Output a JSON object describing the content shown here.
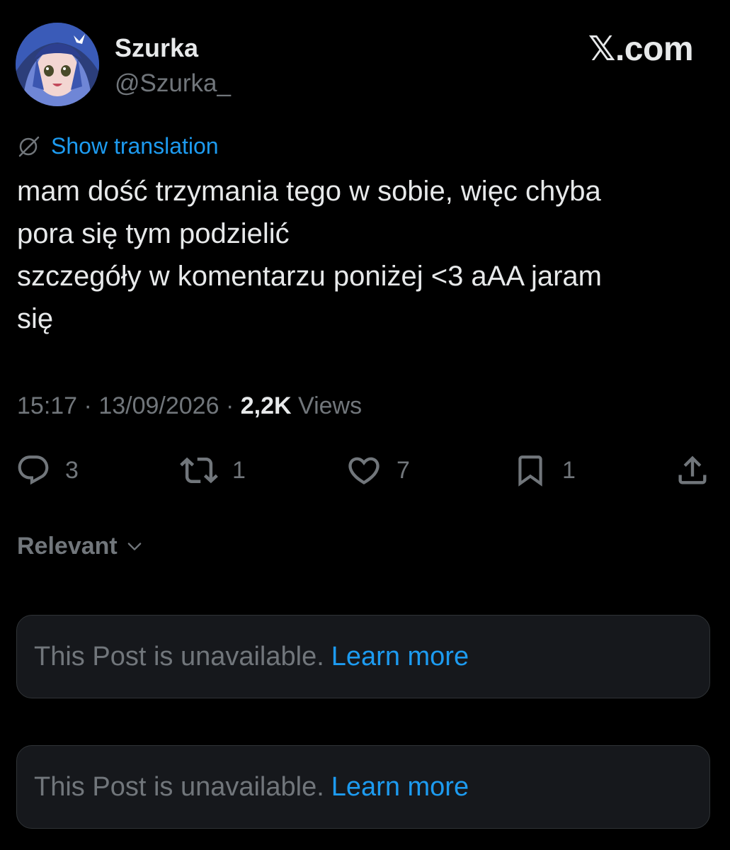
{
  "author": {
    "display_name": "Szurka",
    "handle": "@Szurka_"
  },
  "brand": "𝕏.com",
  "translation": {
    "label": "Show translation",
    "icon": "globe-slash-icon"
  },
  "post": {
    "lines": [
      "mam dość trzymania tego w sobie, więc chyba",
      "pora się tym podzielić",
      "szczegóły w komentarzu poniżej <3 aAA jaram",
      "się"
    ]
  },
  "meta": {
    "time": "15:17",
    "separator": "·",
    "date": "13/09/2026",
    "views_count": "2,2K",
    "views_label": "Views"
  },
  "actions": {
    "replies": "3",
    "reposts": "1",
    "likes": "7",
    "bookmarks": "1"
  },
  "sort": {
    "label": "Relevant"
  },
  "replies": [
    {
      "text": "This Post is unavailable.",
      "link": "Learn more"
    },
    {
      "text": "This Post is unavailable.",
      "link": "Learn more"
    }
  ],
  "colors": {
    "background": "#000000",
    "primary_text": "#e7e9ea",
    "secondary_text": "#71767b",
    "accent": "#1d9bf0",
    "card": "#16181c"
  }
}
